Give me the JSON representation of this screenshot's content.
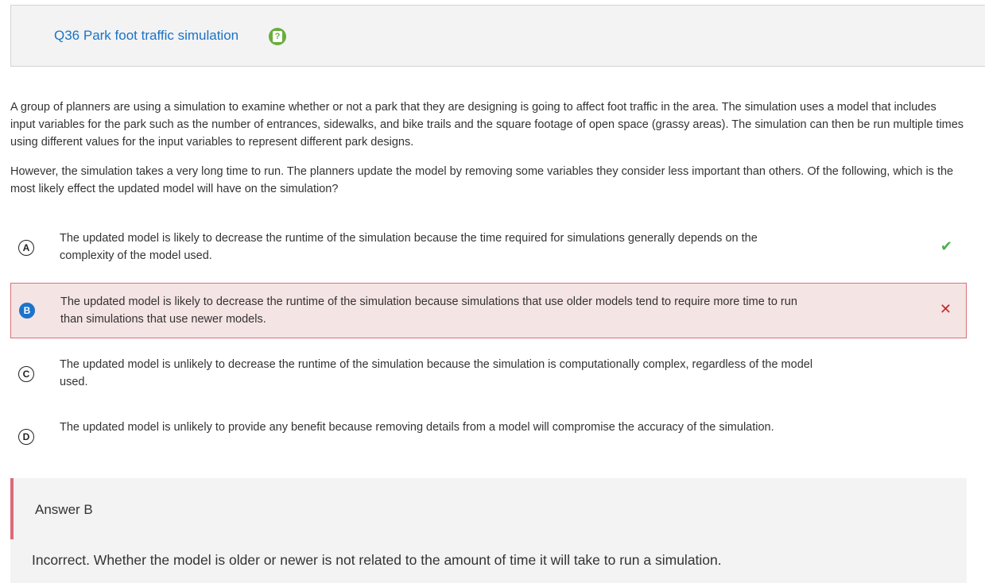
{
  "question": {
    "title": "Q36 Park foot traffic simulation",
    "help_icon": "help-question-icon"
  },
  "passage": {
    "paragraph1": "A group of planners are using a simulation to examine whether or not a park that they are designing is going to affect foot traffic in the area. The simulation uses a model that includes input variables for the park such as the number of entrances, sidewalks, and bike trails and the square footage of open space (grassy areas). The simulation can then be run multiple times using different values for the input variables to represent different park designs.",
    "paragraph2": "However, the simulation takes a very long time to run. The planners update the model by removing some variables they consider less important than others. Of the following, which is the most likely effect the updated model will have on the simulation?"
  },
  "choices": [
    {
      "letter": "A",
      "text": "The updated model is likely to decrease the runtime of the simulation because the time required for simulations generally depends on the complexity of the model used.",
      "status": "correct",
      "mark": "✔"
    },
    {
      "letter": "B",
      "text": "The updated model is likely to decrease the runtime of the simulation because simulations that use older models tend to require more time to run than simulations that use newer models.",
      "status": "selected-incorrect",
      "mark": "✕"
    },
    {
      "letter": "C",
      "text": "The updated model is unlikely to decrease the runtime of the simulation because the simulation is computationally complex, regardless of the model used."
    },
    {
      "letter": "D",
      "text": "The updated model is unlikely to provide any benefit because removing details from a model will compromise the accuracy of the simulation."
    }
  ],
  "answer": {
    "label": "Answer B",
    "explanation": "Incorrect. Whether the model is older or newer is not related to the amount of time it will take to run a simulation."
  },
  "colors": {
    "title_link": "#1a73c7",
    "help_icon": "#6aad3d",
    "correct": "#4caf50",
    "incorrect": "#c62828",
    "wrong_bg": "#f5e4e4",
    "wrong_border": "#d9707b",
    "selected_letter": "#1b74c9"
  }
}
